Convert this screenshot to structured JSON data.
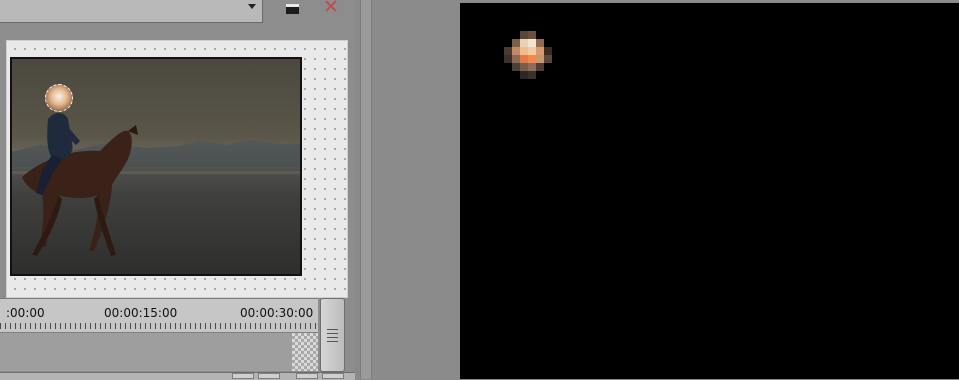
{
  "left_panel": {
    "preset_dropdown": {
      "value": ""
    },
    "timeline_ruler": {
      "labels": [
        ":00:00",
        "00:00:15:00",
        "00:00:30:00"
      ]
    }
  },
  "output_preview": {},
  "colors": {
    "close_icon": "#c44a4a",
    "output_background": "#000000",
    "canvas_background": "#e9e9e9"
  },
  "icons": [
    "dropdown-caret-icon",
    "save-icon",
    "close-icon",
    "scrollbar-grip-icon"
  ]
}
